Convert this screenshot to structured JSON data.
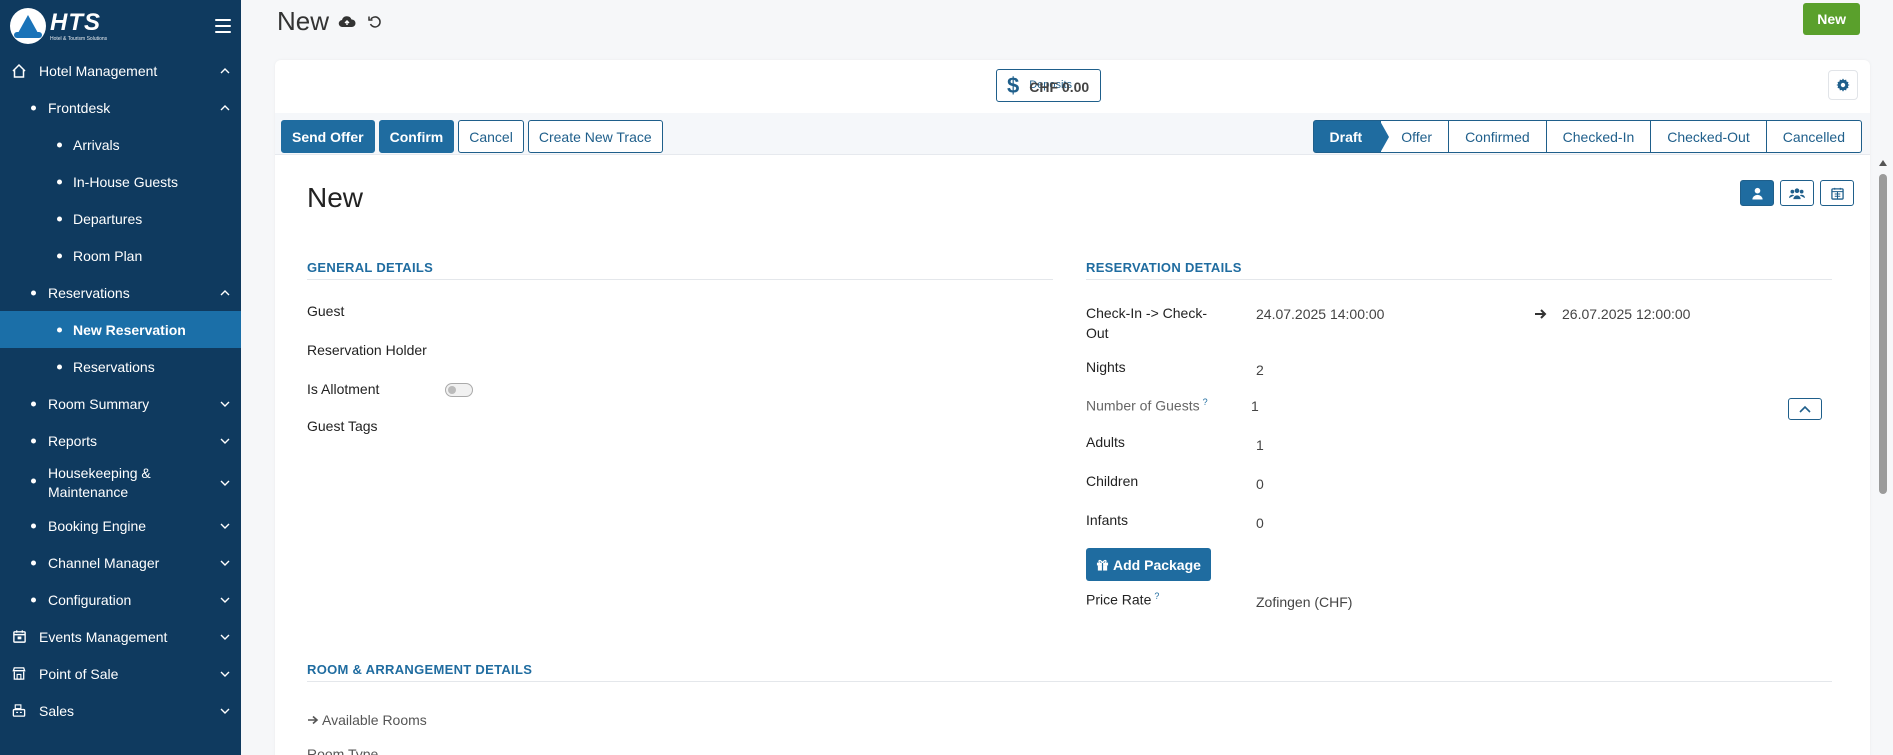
{
  "sidebar": {
    "logo_text": "HTS",
    "logo_tagline": "Hotel & Tourism Solutions",
    "items": [
      {
        "label": "Hotel Management"
      },
      {
        "label": "Frontdesk"
      },
      {
        "label": "Arrivals"
      },
      {
        "label": "In-House Guests"
      },
      {
        "label": "Departures"
      },
      {
        "label": "Room Plan"
      },
      {
        "label": "Reservations"
      },
      {
        "label": "New Reservation"
      },
      {
        "label": "Reservations"
      },
      {
        "label": "Room Summary"
      },
      {
        "label": "Reports"
      },
      {
        "label": "Housekeeping & Maintenance"
      },
      {
        "label": "Booking Engine"
      },
      {
        "label": "Channel Manager"
      },
      {
        "label": "Configuration"
      },
      {
        "label": "Events Management"
      },
      {
        "label": "Point of Sale"
      },
      {
        "label": "Sales"
      }
    ]
  },
  "header": {
    "title": "New",
    "new_button": "New"
  },
  "deposits": {
    "label": "Deposits",
    "value": "CHF 0.00"
  },
  "actions": {
    "send_offer": "Send Offer",
    "confirm": "Confirm",
    "cancel": "Cancel",
    "create_trace": "Create New Trace"
  },
  "status_stages": [
    "Draft",
    "Offer",
    "Confirmed",
    "Checked-In",
    "Checked-Out",
    "Cancelled"
  ],
  "form": {
    "title": "New",
    "general": {
      "heading": "GENERAL DETAILS",
      "guest": "Guest",
      "holder": "Reservation Holder",
      "allotment": "Is Allotment",
      "tags": "Guest Tags"
    },
    "reservation": {
      "heading": "RESERVATION DETAILS",
      "checkin_label": "Check-In -> Check-Out",
      "checkin": "24.07.2025 14:00:00",
      "checkout": "26.07.2025 12:00:00",
      "nights_label": "Nights",
      "nights": "2",
      "guests_label": "Number of Guests",
      "guests": "1",
      "adults_label": "Adults",
      "adults": "1",
      "children_label": "Children",
      "children": "0",
      "infants_label": "Infants",
      "infants": "0",
      "add_package": "Add Package",
      "price_rate_label": "Price Rate",
      "price_rate": "Zofingen (CHF)",
      "help_mark": "?"
    },
    "rooms": {
      "heading": "ROOM & ARRANGEMENT DETAILS",
      "available": "Available Rooms",
      "room_type": "Room Type"
    }
  },
  "colors": {
    "sidebar_bg": "#0f3a5f",
    "active_item": "#1b6fa8",
    "primary": "#1f6ca0",
    "new_button": "#5aa02c"
  }
}
